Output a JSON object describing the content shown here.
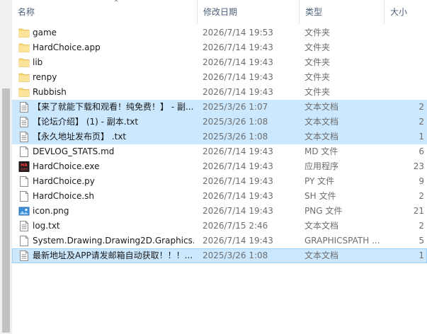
{
  "columns": {
    "name": "名称",
    "modified": "修改日期",
    "type": "类型",
    "size": "大小"
  },
  "files": [
    {
      "name": "game",
      "date": "2026/7/14 19:53",
      "type": "文件夹",
      "size": "",
      "icon": "folder-icon",
      "selected": false
    },
    {
      "name": "HardChoice.app",
      "date": "2026/7/14 19:43",
      "type": "文件夹",
      "size": "",
      "icon": "folder-icon",
      "selected": false
    },
    {
      "name": "lib",
      "date": "2026/7/14 19:43",
      "type": "文件夹",
      "size": "",
      "icon": "folder-icon",
      "selected": false
    },
    {
      "name": "renpy",
      "date": "2026/7/14 19:43",
      "type": "文件夹",
      "size": "",
      "icon": "folder-icon",
      "selected": false
    },
    {
      "name": "Rubbish",
      "date": "2026/7/14 19:43",
      "type": "文件夹",
      "size": "",
      "icon": "folder-icon",
      "selected": false
    },
    {
      "name": "【来了就能下载和观看！纯免费！】 - 副...",
      "date": "2025/3/26 1:07",
      "type": "文本文档",
      "size": "2",
      "icon": "text-file-icon",
      "selected": true
    },
    {
      "name": "【论坛介绍】 (1) - 副本.txt",
      "date": "2025/3/26 1:08",
      "type": "文本文档",
      "size": "2",
      "icon": "text-file-icon",
      "selected": true
    },
    {
      "name": "【永久地址发布页】 .txt",
      "date": "2025/3/26 1:08",
      "type": "文本文档",
      "size": "1",
      "icon": "text-file-icon",
      "selected": true
    },
    {
      "name": "DEVLOG_STATS.md",
      "date": "2026/7/14 19:43",
      "type": "MD 文件",
      "size": "6",
      "icon": "file-icon",
      "selected": false
    },
    {
      "name": "HardChoice.exe",
      "date": "2026/7/14 19:43",
      "type": "应用程序",
      "size": "23",
      "icon": "exe-icon",
      "selected": false
    },
    {
      "name": "HardChoice.py",
      "date": "2026/7/14 19:43",
      "type": "PY 文件",
      "size": "9",
      "icon": "file-icon",
      "selected": false
    },
    {
      "name": "HardChoice.sh",
      "date": "2026/7/14 19:43",
      "type": "SH 文件",
      "size": "2",
      "icon": "file-icon",
      "selected": false
    },
    {
      "name": "icon.png",
      "date": "2026/7/14 19:43",
      "type": "PNG 文件",
      "size": "21",
      "icon": "image-icon",
      "selected": false
    },
    {
      "name": "log.txt",
      "date": "2026/7/15 2:46",
      "type": "文本文档",
      "size": "2",
      "icon": "text-file-icon",
      "selected": false
    },
    {
      "name": "System.Drawing.Drawing2D.Graphics...",
      "date": "2026/7/14 19:43",
      "type": "GRAPHICSPATH ...",
      "size": "5",
      "icon": "file-icon",
      "selected": false
    },
    {
      "name": "最新地址及APP请发邮箱自动获取！！！...",
      "date": "2025/3/26 1:08",
      "type": "文本文档",
      "size": "1",
      "icon": "text-file-icon",
      "selected": true
    }
  ],
  "exe_icon_label": "HA",
  "colors": {
    "selection": "#cce8ff",
    "folder": "#f8d775",
    "header_text": "#4c607a"
  }
}
